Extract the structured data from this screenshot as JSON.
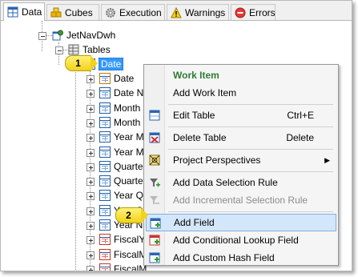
{
  "tabs": [
    {
      "label": "Data",
      "icon": "grid-icon",
      "active": true
    },
    {
      "label": "Cubes",
      "icon": "cubes-icon",
      "active": false
    },
    {
      "label": "Execution",
      "icon": "gear-icon",
      "active": false
    },
    {
      "label": "Warnings",
      "icon": "warning-icon",
      "active": false
    },
    {
      "label": "Errors",
      "icon": "error-icon",
      "active": false
    }
  ],
  "tree": {
    "database": "JetNavDwh",
    "tables_folder": "Tables",
    "selected_table": "Date",
    "children": [
      "Date",
      "Date Na",
      "Month N",
      "Month N",
      "Year Mo",
      "Year Mo",
      "Quarter",
      "Quarter",
      "Year Qu",
      "Year Qu",
      "Year N",
      "FiscalYe",
      "FiscalM",
      "FiscalM"
    ]
  },
  "callouts": [
    "1",
    "2"
  ],
  "context_menu": {
    "items": [
      {
        "label": "Work Item",
        "type": "header"
      },
      {
        "label": "Add Work Item"
      },
      {
        "type": "separator"
      },
      {
        "label": "Edit Table",
        "shortcut": "Ctrl+E",
        "icon": "edit-table-icon"
      },
      {
        "type": "separator"
      },
      {
        "label": "Delete Table",
        "shortcut": "Delete",
        "icon": "delete-table-icon"
      },
      {
        "type": "separator"
      },
      {
        "label": "Project Perspectives",
        "submenu": true,
        "icon": "perspectives-icon"
      },
      {
        "type": "separator"
      },
      {
        "label": "Add Data Selection Rule",
        "icon": "funnel-add-icon"
      },
      {
        "label": "Add Incremental Selection Rule",
        "disabled": true,
        "icon": "incremental-rule-icon"
      },
      {
        "type": "separator"
      },
      {
        "label": "Add Field",
        "highlighted": true,
        "icon": "add-field-icon"
      },
      {
        "label": "Add Conditional Lookup Field",
        "icon": "add-lookup-field-icon"
      },
      {
        "label": "Add Custom Hash Field",
        "icon": "add-hash-field-icon"
      }
    ]
  },
  "colors": {
    "selection": "#3399ff",
    "menu_highlight": "#d4e6fa",
    "header_text": "#2e7d32",
    "callout": "#f2d21a"
  }
}
